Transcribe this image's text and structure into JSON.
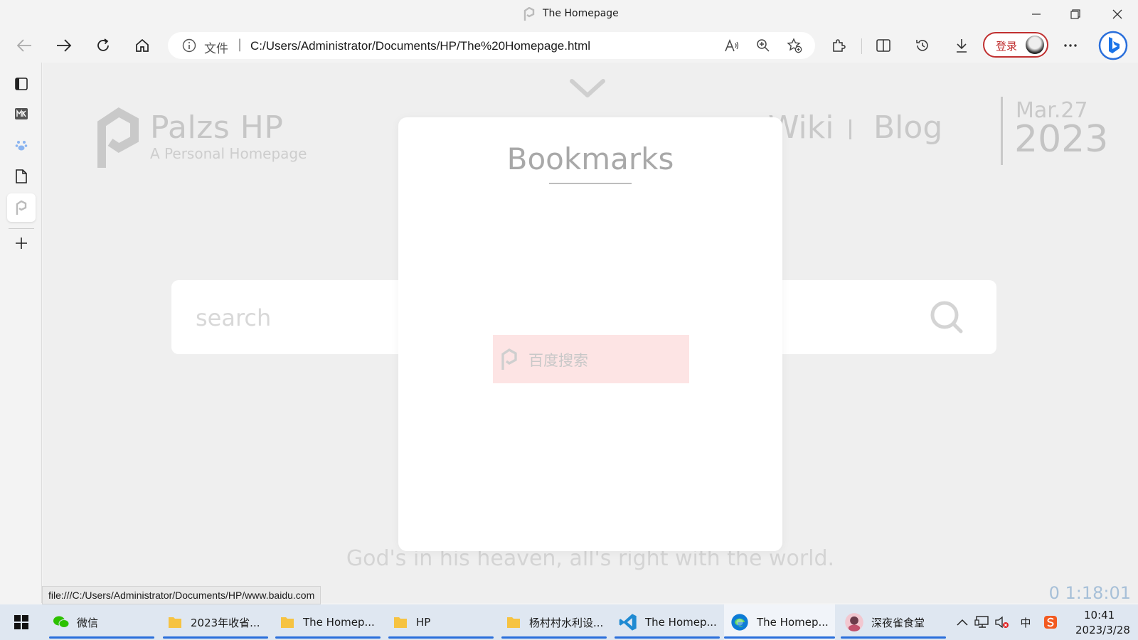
{
  "browser": {
    "window_title": "The Homepage",
    "address": {
      "scheme_label": "文件",
      "separator": "|",
      "url": "C:/Users/Administrator/Documents/HP/The%20Homepage.html"
    },
    "login_label": "登录",
    "status_url": "file:///C:/Users/Administrator/Documents/HP/www.baidu.com"
  },
  "page": {
    "brand": {
      "name": "Palzs HP",
      "subtitle": "A Personal Homepage"
    },
    "nav": {
      "wiki": "Wiki",
      "blog": "Blog"
    },
    "date": {
      "month_day": "Mar.27",
      "year": "2023"
    },
    "search": {
      "placeholder": "search"
    },
    "quote": "God's in his heaven, all's right with the world.",
    "timer": "0 1:18:01"
  },
  "modal": {
    "title": "Bookmarks",
    "items": [
      {
        "label": "百度搜索",
        "highlight_color": "#fde4e4"
      }
    ]
  },
  "taskbar": {
    "items": [
      {
        "label": "微信"
      },
      {
        "label": "2023年收省..."
      },
      {
        "label": "The Homep..."
      },
      {
        "label": "HP"
      },
      {
        "label": "杨村村水利设..."
      },
      {
        "label": "The Homep..."
      },
      {
        "label": "The Homep..."
      },
      {
        "label": "深夜雀食堂"
      }
    ],
    "tray": {
      "ime": "中",
      "time": "10:41",
      "date": "2023/3/28"
    }
  },
  "colors": {
    "accent_blue": "#2a6fdb",
    "login_red": "#c03030",
    "timer_blue": "#a7c0d8"
  }
}
